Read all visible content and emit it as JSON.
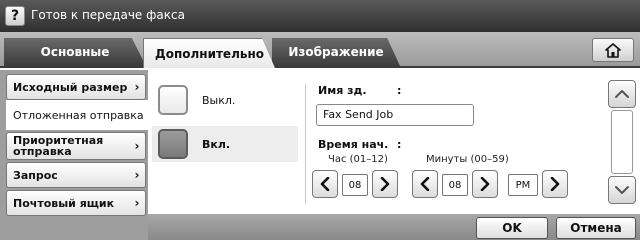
{
  "header": {
    "help_label": "?",
    "title": "Готов к передаче факса"
  },
  "tabs": [
    {
      "label": "Основные"
    },
    {
      "label": "Дополнительно"
    },
    {
      "label": "Изображение"
    }
  ],
  "home_icon": "home-icon",
  "sidebar": {
    "items": [
      {
        "label": "Исходный размер",
        "chevron": "›"
      },
      {
        "label": "Отложенная отправка",
        "chevron": ""
      },
      {
        "label": "Приоритетная отправка",
        "chevron": "›"
      },
      {
        "label": "Запрос",
        "chevron": "›"
      },
      {
        "label": "Почтовый ящик",
        "chevron": "›"
      }
    ],
    "selected_index": 1
  },
  "options": {
    "off_label": "Выкл.",
    "on_label": "Вкл.",
    "selected": "on"
  },
  "job": {
    "name_label": "Имя зд.",
    "colon": ":",
    "name_value": "Fax Send Job",
    "time_label": "Время нач.",
    "hour_label": "Час (01–12)",
    "minute_label": "Минуты (00–59)",
    "hour_value": "08",
    "minute_value": "08",
    "ampm_value": "PM"
  },
  "footer": {
    "ok_label": "OK",
    "cancel_label": "Отмена"
  },
  "colors": {
    "titlebar": "#3f3f3f",
    "tabrow": "#a8a8a8",
    "sidebar": "#9e9e9e",
    "selected_option": "#8a8a8a"
  }
}
